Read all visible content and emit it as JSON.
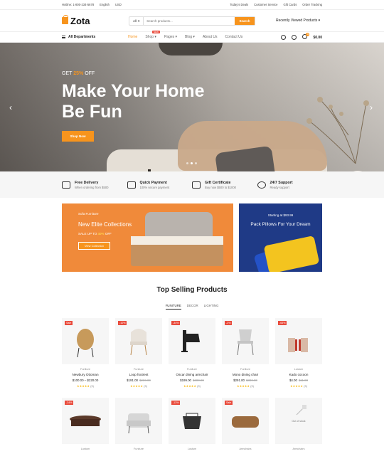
{
  "topbar": {
    "hotline": "Hotline: 1-800-234-5678",
    "language": "English",
    "currency": "USD",
    "links": [
      "Today's Deals",
      "Customer Service",
      "Gift Cards",
      "Order Tracking"
    ]
  },
  "header": {
    "logo": "Zota",
    "search": {
      "category": "All",
      "placeholder": "Search products...",
      "button": "Search"
    },
    "recent": "Recently Viewed Products"
  },
  "nav": {
    "all_departments": "All Departments",
    "items": [
      "Home",
      "Shop",
      "Pages",
      "Blog",
      "About Us",
      "Contact Us"
    ],
    "new_badge": "NEW",
    "cart_total": "$0.00",
    "cart_count": "0"
  },
  "hero": {
    "offer_prefix": "GET",
    "offer_value": "25%",
    "offer_suffix": "OFF",
    "title": "Make Your Home Be Fun",
    "button": "Shop Now"
  },
  "features": [
    {
      "title": "Free Delivery",
      "subtitle": "When ordering from $500"
    },
    {
      "title": "Quick Payment",
      "subtitle": "100% secure payment"
    },
    {
      "title": "Gift Certificate",
      "subtitle": "Buy now $500 to $1000"
    },
    {
      "title": "24/7 Support",
      "subtitle": "Ready support"
    }
  ],
  "banner_left": {
    "label": "Sofa Furniture",
    "title": "New Elite Collections",
    "sale_prefix": "SALE UP TO",
    "sale_value": "40%",
    "sale_suffix": "OFF",
    "button": "View Collection"
  },
  "banner_right": {
    "starting": "Starting at $93.99",
    "title": "Pack Pillows For Your Dream"
  },
  "section": {
    "title": "Top Selling Products",
    "tabs": [
      "FUNITURE",
      "DECOR",
      "LIGHTING"
    ]
  },
  "products": [
    {
      "badge": "Sale",
      "category": "Funiture",
      "name": "Newbury Ottoman",
      "price": "$100.00 – $220.00",
      "old": "",
      "rating": "★★★★★",
      "count": "(3)"
    },
    {
      "badge": "-10%",
      "category": "Funiture",
      "name": "Loop footrest",
      "price": "$191.00",
      "old": "$200.00",
      "rating": "★★★★★",
      "count": "(3)"
    },
    {
      "badge": "-34%",
      "category": "Funiture",
      "name": "Oscar dining armchair",
      "price": "$199.00",
      "old": "$300.00",
      "rating": "★★★★★",
      "count": "(3)"
    },
    {
      "badge": "-3%",
      "category": "Funiture",
      "name": "Mono dining chair",
      "price": "$291.00",
      "old": "$300.00",
      "rating": "★★★★★",
      "count": "(3)"
    },
    {
      "badge": "-64%",
      "category": "Lustum",
      "name": "Kado cocoon",
      "price": "$4.00",
      "old": "$11.00",
      "rating": "★★★★★",
      "count": "(3)"
    },
    {
      "badge": "-34%",
      "category": "Lustum",
      "name": "",
      "price": "",
      "old": "",
      "rating": "",
      "count": ""
    },
    {
      "badge": "",
      "category": "Funiture",
      "name": "",
      "price": "",
      "old": "",
      "rating": "",
      "count": ""
    },
    {
      "badge": "-13%",
      "category": "Lustum",
      "name": "",
      "price": "",
      "old": "",
      "rating": "",
      "count": ""
    },
    {
      "badge": "Sale",
      "category": "Armchairs",
      "name": "",
      "price": "",
      "old": "",
      "rating": "",
      "count": ""
    },
    {
      "badge": "",
      "category": "Armchairs",
      "name": "",
      "price": "",
      "old": "",
      "rating": "",
      "count": "",
      "out": "Out of stock"
    }
  ]
}
